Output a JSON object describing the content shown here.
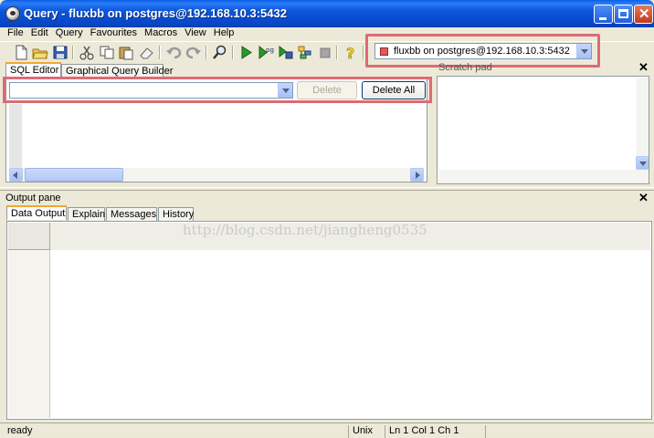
{
  "window": {
    "title": "Query - fluxbb on postgres@192.168.10.3:5432"
  },
  "menu": [
    "File",
    "Edit",
    "Query",
    "Favourites",
    "Macros",
    "View",
    "Help"
  ],
  "toolbar": {
    "connection": "fluxbb on postgres@192.168.10.3:5432",
    "icons": [
      "new-file-icon",
      "open-folder-icon",
      "save-icon",
      "cut-icon",
      "copy-icon",
      "paste-icon",
      "eraser-icon",
      "undo-icon",
      "redo-icon",
      "find-icon",
      "execute-icon",
      "execute-pgscript-icon",
      "execute-to-file-icon",
      "explain-icon",
      "stop-icon",
      "help-icon"
    ]
  },
  "editor": {
    "tabs": [
      "SQL Editor",
      "Graphical Query Builder"
    ],
    "query_value": "",
    "delete_label": "Delete",
    "delete_all_label": "Delete All"
  },
  "scratch_pad": {
    "label": "Scratch pad",
    "close": "✕"
  },
  "output": {
    "label": "Output pane",
    "close": "✕",
    "tabs": [
      "Data Output",
      "Explain",
      "Messages",
      "History"
    ],
    "watermark": "http://blog.csdn.net/jiangheng0535"
  },
  "status": {
    "state": "ready",
    "line_endings": "Unix",
    "position": "Ln 1 Col 1 Ch 1"
  },
  "colors": {
    "highlight": "#dd6b73",
    "titlebar": "#0b56db",
    "chrome": "#ece9d8"
  }
}
